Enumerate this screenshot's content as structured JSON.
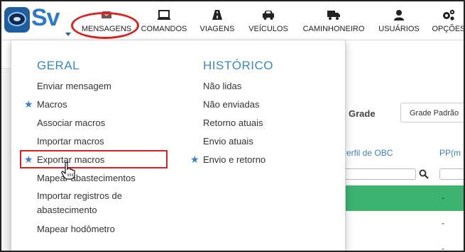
{
  "app": {
    "logo_text": "Sv"
  },
  "nav": {
    "items": [
      {
        "label": "MENSAGENS",
        "icon": "envelope-icon"
      },
      {
        "label": "COMANDOS",
        "icon": "monitor-icon"
      },
      {
        "label": "VIAGENS",
        "icon": "road-icon"
      },
      {
        "label": "VEÍCULOS",
        "icon": "car-icon"
      },
      {
        "label": "CAMINHONEIRO",
        "icon": "truck-icon"
      },
      {
        "label": "USUÁRIOS",
        "icon": "user-icon"
      },
      {
        "label": "OPÇÕES",
        "icon": "gears-icon"
      }
    ]
  },
  "dropdown": {
    "geral": {
      "title": "GERAL",
      "items": [
        "Enviar mensagem",
        "Macros",
        "Associar macros",
        "Importar macros",
        "Exportar macros",
        "Mapear abastecimentos",
        "Importar registros de abastecimento",
        "Mapear hodômetro"
      ]
    },
    "historico": {
      "title": "HISTÓRICO",
      "items": [
        "Não lidas",
        "Não enviadas",
        "Retorno atuais",
        "Envio atuais",
        "Envio e retorno"
      ]
    }
  },
  "background": {
    "grade_label": "Grade",
    "grade_select": "Grade Padrão",
    "columns": [
      "Perfil de OBC",
      "PP(m"
    ],
    "cells": [
      "-",
      "-",
      "-"
    ]
  },
  "colors": {
    "accent": "#3a86c8",
    "highlight": "#d9241f",
    "row_green": "#3cb371"
  }
}
